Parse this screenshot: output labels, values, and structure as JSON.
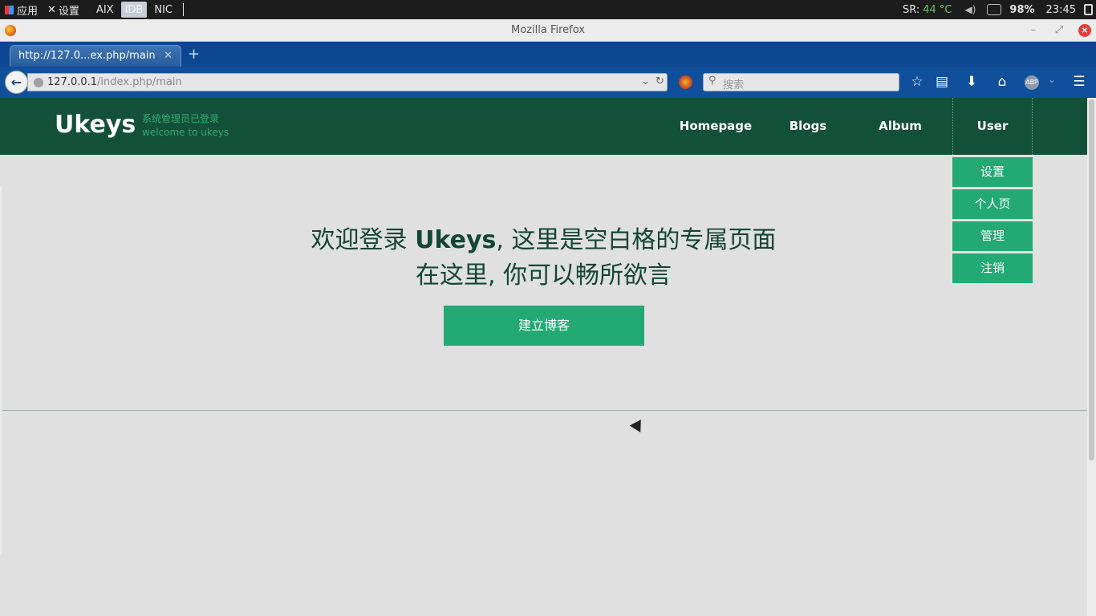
{
  "os_panel": {
    "apps_label": "应用",
    "settings_label": "设置",
    "workspaces": [
      "AIX",
      "IDB",
      "NIC"
    ],
    "sr_label": "SR:",
    "temperature": "44 °C",
    "battery": "98%",
    "clock": "23:45"
  },
  "window": {
    "title": "Mozilla Firefox"
  },
  "tab": {
    "title": "http://127.0...ex.php/main"
  },
  "navbar": {
    "url_host": "127.0.0.1",
    "url_path": "/index.php/main",
    "search_placeholder": "搜索"
  },
  "site": {
    "logo": "Ukeys",
    "tagline_line1": "系统管理员已登录",
    "tagline_line2": "welcome to ukeys",
    "nav": [
      {
        "label": "Homepage"
      },
      {
        "label": "Blogs"
      },
      {
        "label": "Album"
      },
      {
        "label": "User"
      }
    ],
    "user_menu": [
      {
        "label": "设置"
      },
      {
        "label": "个人页"
      },
      {
        "label": "管理"
      },
      {
        "label": "注销"
      }
    ],
    "welcome_line1_prefix": "欢迎登录 ",
    "welcome_line1_brand": "Ukeys",
    "welcome_line1_suffix": ", 这里是空白格的专属页面",
    "welcome_line2": "在这里, 你可以畅所欲言",
    "create_blog_button": "建立博客"
  },
  "colors": {
    "header_bg": "#135039",
    "accent": "#23a974",
    "browser_blue": "#104f9b"
  }
}
